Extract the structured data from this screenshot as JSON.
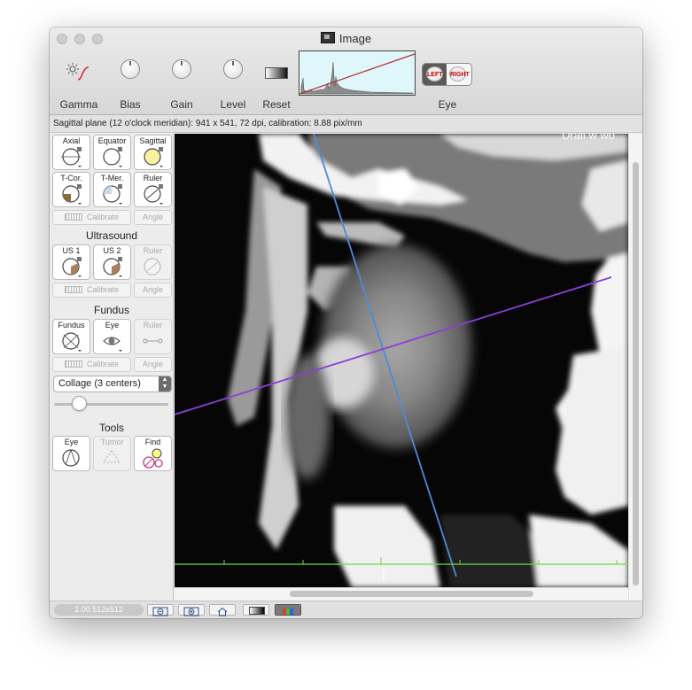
{
  "window": {
    "title": "Image"
  },
  "toolbar": {
    "gamma_label": "Gamma",
    "bias_label": "Bias",
    "gain_label": "Gain",
    "level_label": "Level",
    "reset_label": "Reset",
    "eye_label": "Eye",
    "left_label": "LEFT",
    "right_label": "RIGHT"
  },
  "info": {
    "text": "Sagittal plane (12 o'clock meridian): 941 x 541, 72 dpi, calibration: 8.88 pix/mm"
  },
  "sidebar": {
    "views": [
      {
        "label": "Axial"
      },
      {
        "label": "Equator"
      },
      {
        "label": "Sagittal"
      },
      {
        "label": "T-Cor."
      },
      {
        "label": "T-Mer."
      },
      {
        "label": "Ruler"
      }
    ],
    "calibrate_label": "Calibrate",
    "angle_label": "Angle",
    "ultrasound": {
      "title": "Ultrasound",
      "items": [
        {
          "label": "US 1"
        },
        {
          "label": "US 2"
        },
        {
          "label": "Ruler"
        }
      ]
    },
    "fundus": {
      "title": "Fundus",
      "items": [
        {
          "label": "Fundus"
        },
        {
          "label": "Eye"
        },
        {
          "label": "Ruler"
        }
      ]
    },
    "collage": {
      "selected": "Collage (3 centers)"
    },
    "slider": {
      "value": 0.18
    },
    "tools": {
      "title": "Tools",
      "items": [
        {
          "label": "Eye"
        },
        {
          "label": "Tumor"
        },
        {
          "label": "Find"
        }
      ]
    }
  },
  "viewer": {
    "overlay_text": "Drall w wo"
  },
  "status": {
    "zoom": "1.00 512x512"
  },
  "colors": {
    "histogram_bg": "#dff6fb",
    "meridian_line": "#4f8ad8",
    "axis_line": "#8a3fd8",
    "scale_line": "#6fd84a",
    "sagittal_highlight": "#f6f2a0"
  }
}
